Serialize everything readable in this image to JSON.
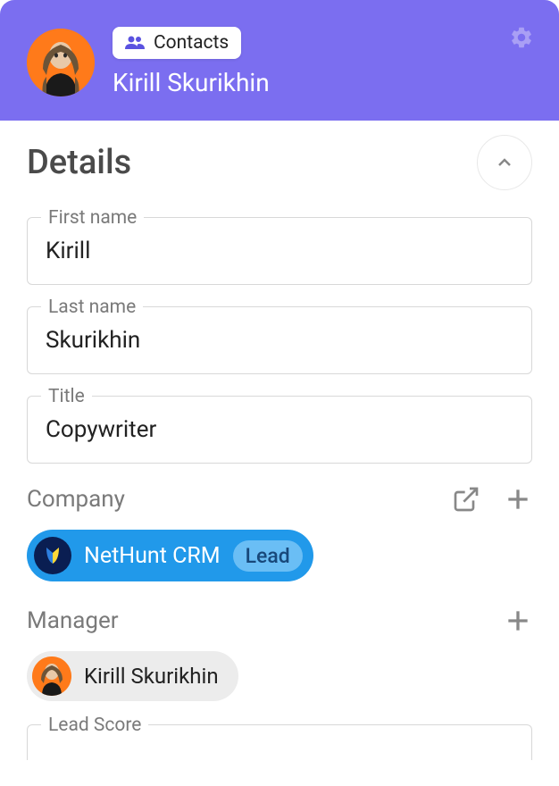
{
  "header": {
    "badge_label": "Contacts",
    "contact_name": "Kirill Skurikhin"
  },
  "details": {
    "section_title": "Details",
    "fields": {
      "first_name": {
        "label": "First name",
        "value": "Kirill"
      },
      "last_name": {
        "label": "Last name",
        "value": "Skurikhin"
      },
      "title": {
        "label": "Title",
        "value": "Copywriter"
      }
    },
    "company": {
      "label": "Company",
      "name": "NetHunt CRM",
      "status": "Lead"
    },
    "manager": {
      "label": "Manager",
      "name": "Kirill Skurikhin"
    },
    "lead_score": {
      "label": "Lead Score"
    }
  }
}
